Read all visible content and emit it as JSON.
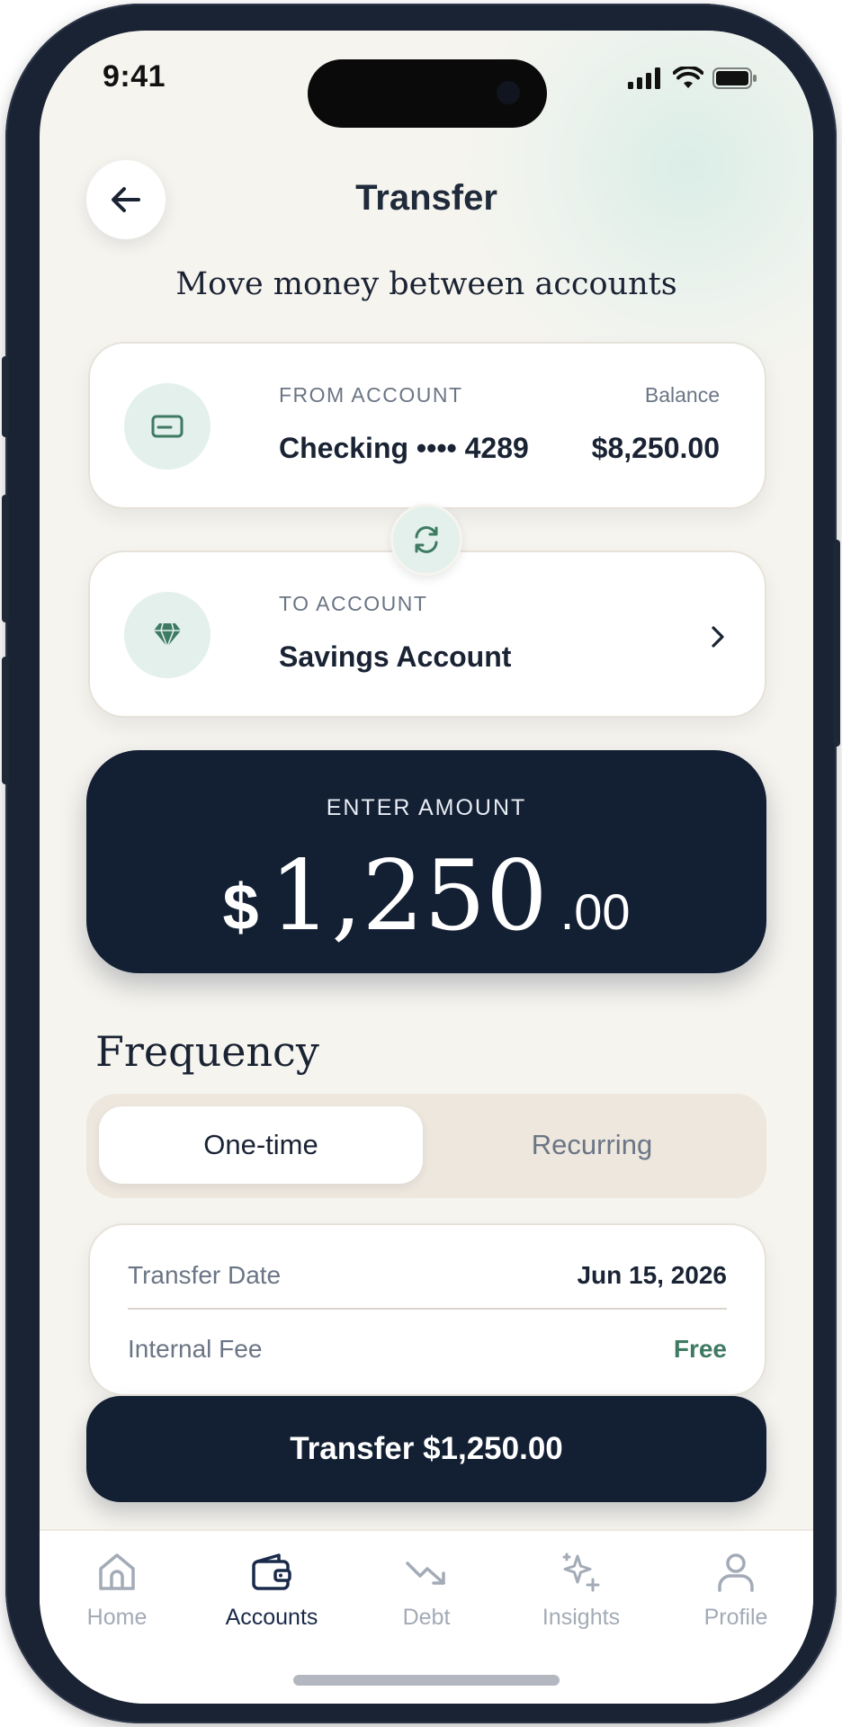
{
  "status_bar": {
    "time": "9:41",
    "icons": [
      "signal-icon",
      "wifi-icon",
      "battery-icon"
    ]
  },
  "header": {
    "title": "Transfer",
    "back_icon": "arrow-left-icon"
  },
  "subtitle": "Move money between accounts",
  "from_account": {
    "label": "FROM ACCOUNT",
    "name": "Checking •••• 4289",
    "balance_label": "Balance",
    "balance_value": "$8,250.00",
    "icon": "card-icon"
  },
  "swap": {
    "icon": "swap-arrows-icon"
  },
  "to_account": {
    "label": "TO ACCOUNT",
    "name": "Savings Account",
    "icon": "diamond-icon",
    "chevron": "chevron-right-icon"
  },
  "amount": {
    "label": "ENTER AMOUNT",
    "currency": "$",
    "whole": "1,250",
    "cents": ".00"
  },
  "frequency": {
    "heading": "Frequency",
    "options": [
      {
        "label": "One-time",
        "selected": true
      },
      {
        "label": "Recurring",
        "selected": false
      }
    ]
  },
  "details": [
    {
      "key": "Transfer Date",
      "value": "Jun 15, 2026"
    },
    {
      "key": "Internal Fee",
      "value": "Free"
    }
  ],
  "cta": {
    "label": "Transfer $1,250.00"
  },
  "tabbar": {
    "items": [
      {
        "label": "Home",
        "icon": "home-icon",
        "active": false
      },
      {
        "label": "Accounts",
        "icon": "wallet-icon",
        "active": true
      },
      {
        "label": "Debt",
        "icon": "trending-down-icon",
        "active": false
      },
      {
        "label": "Insights",
        "icon": "sparkles-icon",
        "active": false
      },
      {
        "label": "Profile",
        "icon": "user-icon",
        "active": false
      }
    ]
  },
  "colors": {
    "background": "#f6f4ef",
    "navy": "#131f33",
    "mint": "#e3f0ec",
    "accent_green": "#3f7a63",
    "muted": "#6b7585"
  }
}
